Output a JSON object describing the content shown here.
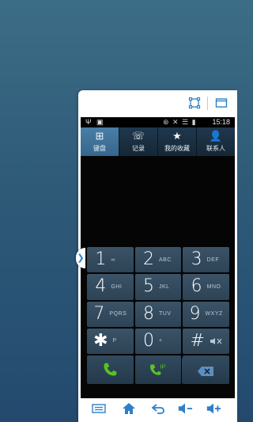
{
  "status_bar": {
    "left_icons": "Ψ ▣",
    "right_icons": "⊛ ✕ ☰ ▮",
    "time": "15:18"
  },
  "tabs": [
    {
      "label": "键盘",
      "icon": "keypad-icon",
      "glyph": "⊞",
      "active": true
    },
    {
      "label": "记录",
      "icon": "call-log-icon",
      "glyph": "☏",
      "active": false
    },
    {
      "label": "我的收藏",
      "icon": "star-icon",
      "glyph": "★",
      "active": false
    },
    {
      "label": "联系人",
      "icon": "contacts-icon",
      "glyph": "👤",
      "active": false
    }
  ],
  "keys": [
    {
      "num": "1",
      "letters": "∞"
    },
    {
      "num": "2",
      "letters": "ABC"
    },
    {
      "num": "3",
      "letters": "DEF"
    },
    {
      "num": "4",
      "letters": "GHI"
    },
    {
      "num": "5",
      "letters": "JKL"
    },
    {
      "num": "6",
      "letters": "MNO"
    },
    {
      "num": "7",
      "letters": "PQRS"
    },
    {
      "num": "8",
      "letters": "TUV"
    },
    {
      "num": "9",
      "letters": "WXYZ"
    },
    {
      "num": "✱",
      "letters": "P"
    },
    {
      "num": "0",
      "letters": "+"
    },
    {
      "num": "#",
      "letters": ""
    }
  ],
  "actions": [
    {
      "name": "call-button",
      "icon": "phone-icon"
    },
    {
      "name": "ip-call-button",
      "icon": "phone-ip-icon",
      "text": "IP"
    },
    {
      "name": "message-button",
      "icon": "envelope-icon"
    },
    {
      "name": "backspace-button",
      "icon": "backspace-icon"
    }
  ],
  "colors": {
    "accent": "#2f7fc8",
    "call_green": "#58c322",
    "message_yellow": "#e8b818"
  }
}
